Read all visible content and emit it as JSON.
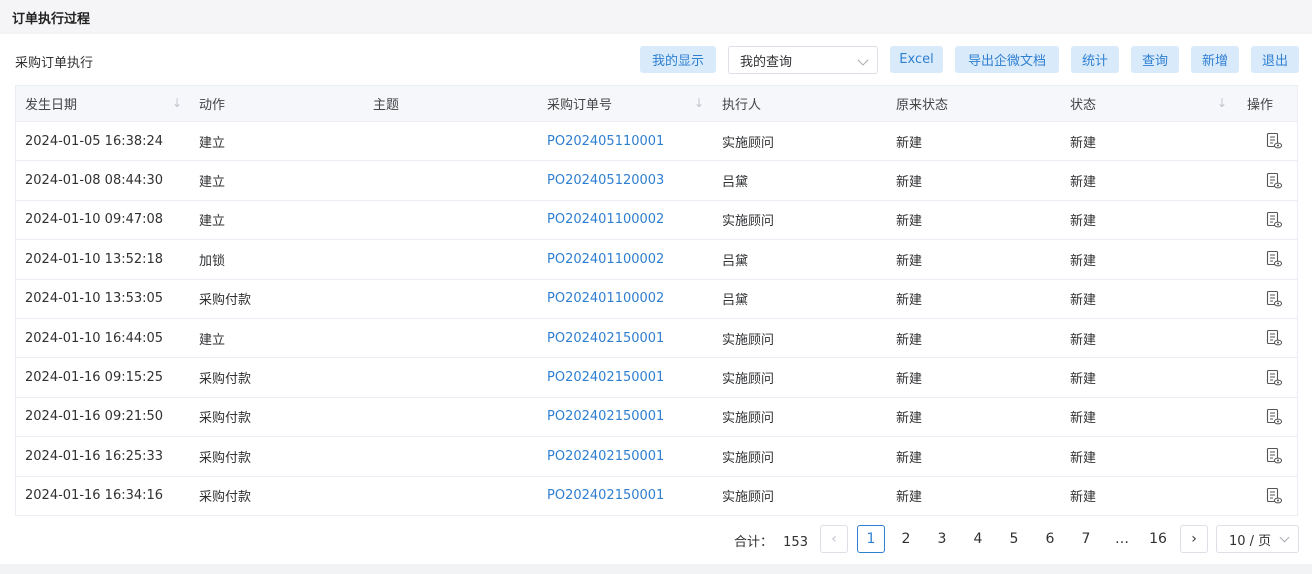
{
  "page_title": "订单执行过程",
  "section_label": "采购订单执行",
  "toolbar": {
    "my_display": "我的显示",
    "my_query_select": "我的查询",
    "excel": "Excel",
    "export_wecom": "导出企微文档",
    "stats": "统计",
    "query": "查询",
    "add": "新增",
    "exit": "退出"
  },
  "table": {
    "columns": [
      "发生日期",
      "动作",
      "主题",
      "采购订单号",
      "执行人",
      "原来状态",
      "状态",
      "操作"
    ],
    "rows": [
      {
        "date": "2024-01-05 16:38:24",
        "action": "建立",
        "subject": "",
        "po": "PO202405110001",
        "executor": "实施顾问",
        "prev_status": "新建",
        "status": "新建"
      },
      {
        "date": "2024-01-08 08:44:30",
        "action": "建立",
        "subject": "",
        "po": "PO202405120003",
        "executor": "吕黛",
        "prev_status": "新建",
        "status": "新建"
      },
      {
        "date": "2024-01-10 09:47:08",
        "action": "建立",
        "subject": "",
        "po": "PO202401100002",
        "executor": "实施顾问",
        "prev_status": "新建",
        "status": "新建"
      },
      {
        "date": "2024-01-10 13:52:18",
        "action": "加锁",
        "subject": "",
        "po": "PO202401100002",
        "executor": "吕黛",
        "prev_status": "新建",
        "status": "新建"
      },
      {
        "date": "2024-01-10 13:53:05",
        "action": "采购付款",
        "subject": "",
        "po": "PO202401100002",
        "executor": "吕黛",
        "prev_status": "新建",
        "status": "新建"
      },
      {
        "date": "2024-01-10 16:44:05",
        "action": "建立",
        "subject": "",
        "po": "PO202402150001",
        "executor": "实施顾问",
        "prev_status": "新建",
        "status": "新建"
      },
      {
        "date": "2024-01-16 09:15:25",
        "action": "采购付款",
        "subject": "",
        "po": "PO202402150001",
        "executor": "实施顾问",
        "prev_status": "新建",
        "status": "新建"
      },
      {
        "date": "2024-01-16 09:21:50",
        "action": "采购付款",
        "subject": "",
        "po": "PO202402150001",
        "executor": "实施顾问",
        "prev_status": "新建",
        "status": "新建"
      },
      {
        "date": "2024-01-16 16:25:33",
        "action": "采购付款",
        "subject": "",
        "po": "PO202402150001",
        "executor": "实施顾问",
        "prev_status": "新建",
        "status": "新建"
      },
      {
        "date": "2024-01-16 16:34:16",
        "action": "采购付款",
        "subject": "",
        "po": "PO202402150001",
        "executor": "实施顾问",
        "prev_status": "新建",
        "status": "新建"
      }
    ]
  },
  "pager": {
    "total_label": "合计：",
    "total": "153",
    "pages": [
      "1",
      "2",
      "3",
      "4",
      "5",
      "6",
      "7",
      "…",
      "16"
    ],
    "current": "1",
    "page_size": "10 / 页"
  },
  "colors": {
    "accent": "#2f7fd1",
    "button_bg": "#d9ebfb"
  }
}
